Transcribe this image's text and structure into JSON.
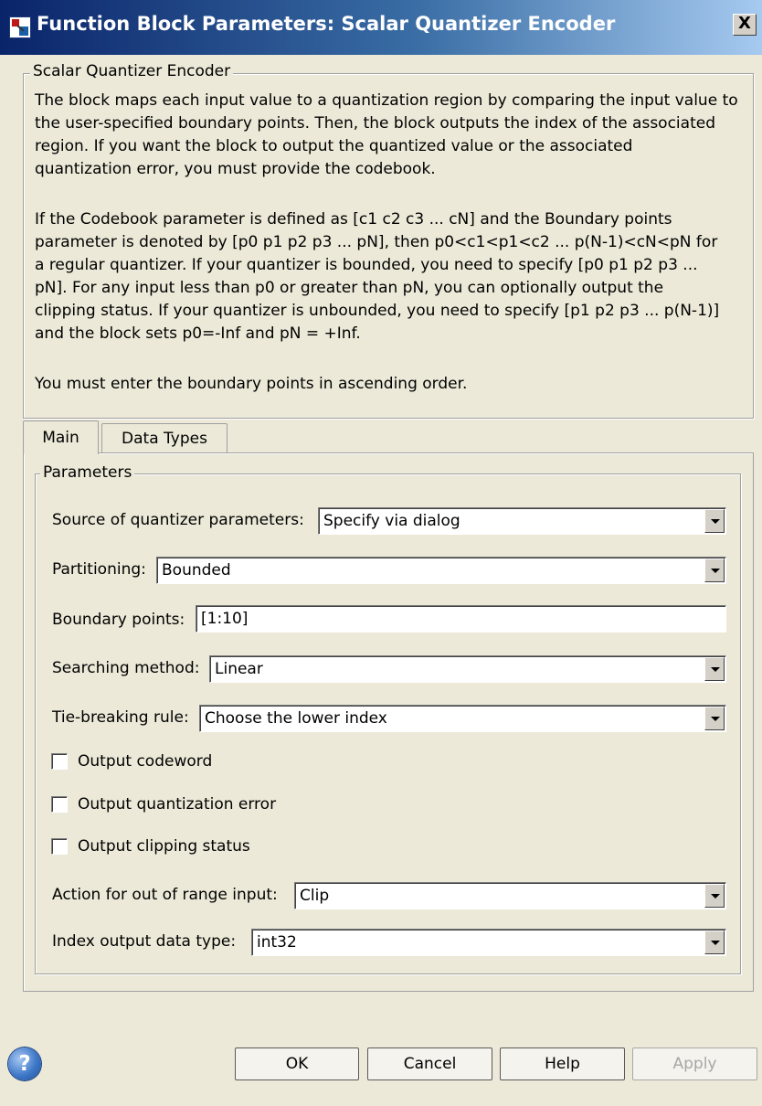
{
  "window": {
    "title": "Function Block Parameters: Scalar Quantizer Encoder",
    "close_label": "X"
  },
  "description": {
    "legend": "Scalar Quantizer Encoder",
    "paragraphs": [
      [
        "The block maps each input value to a quantization region by comparing the input value to",
        "the user-specified boundary points. Then, the block outputs the index of the associated",
        "region. If you want the block to output the quantized value or the associated",
        "quantization error, you must provide the codebook."
      ],
      [
        "If the Codebook parameter is defined as [c1 c2 c3 ... cN] and the Boundary points",
        "parameter is denoted by [p0 p1 p2 p3 ... pN], then p0<c1<p1<c2 ... p(N-1)<cN<pN for",
        "a regular quantizer. If your quantizer is bounded, you need to specify [p0 p1 p2 p3 ...",
        "pN]. For any input less than p0 or greater than pN, you can optionally output the",
        "clipping status. If your quantizer is unbounded, you need to specify [p1 p2 p3 ... p(N-1)]",
        "and the block sets p0=-Inf and pN = +Inf."
      ],
      [
        "You must enter the boundary points in ascending order."
      ]
    ]
  },
  "tabs": [
    {
      "label": "Main",
      "active": true
    },
    {
      "label": "Data Types",
      "active": false
    }
  ],
  "parameters": {
    "legend": "Parameters",
    "source": {
      "label": "Source of quantizer parameters:",
      "value": "Specify via dialog"
    },
    "partitioning": {
      "label": "Partitioning:",
      "value": "Bounded"
    },
    "boundary": {
      "label": "Boundary points:",
      "value": "[1:10]"
    },
    "searching": {
      "label": "Searching method:",
      "value": "Linear"
    },
    "tiebreak": {
      "label": "Tie-breaking rule:",
      "value": "Choose the lower index"
    },
    "checkboxes": [
      {
        "label": "Output codeword",
        "checked": false
      },
      {
        "label": "Output quantization error",
        "checked": false
      },
      {
        "label": "Output clipping status",
        "checked": false
      }
    ],
    "action": {
      "label": "Action for out of range input:",
      "value": "Clip"
    },
    "index_type": {
      "label": "Index output data type:",
      "value": "int32"
    }
  },
  "buttons": {
    "help_icon": "?",
    "ok": "OK",
    "cancel": "Cancel",
    "help": "Help",
    "apply": "Apply"
  }
}
